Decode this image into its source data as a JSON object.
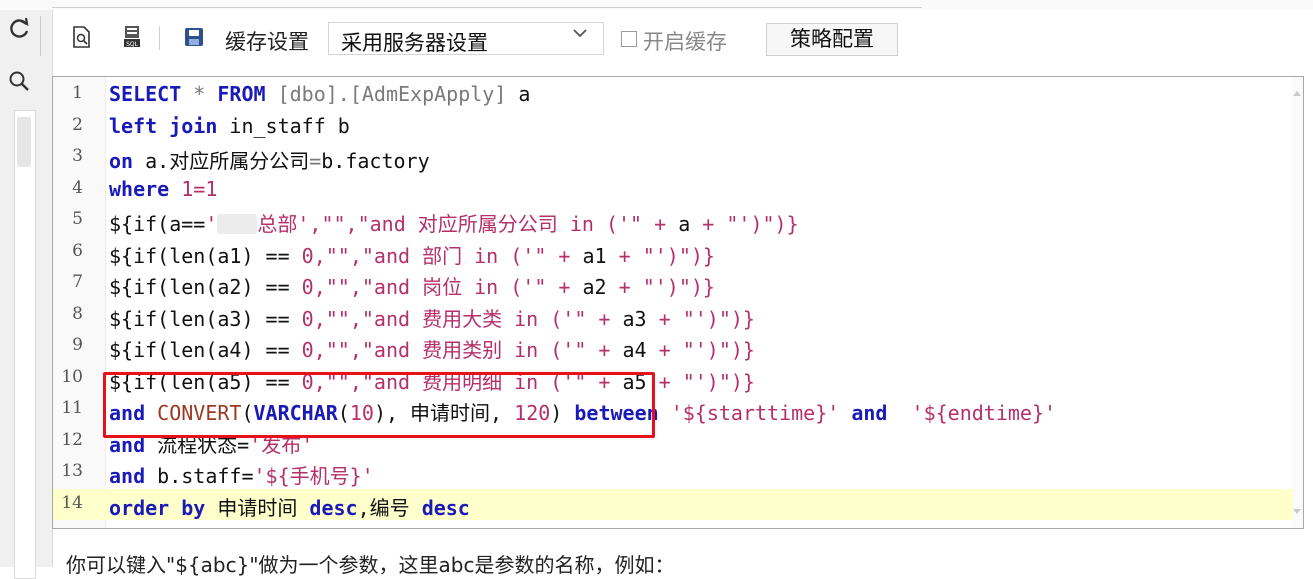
{
  "toolbar": {
    "cache_label": "缓存设置",
    "cache_select_value": "采用服务器设置",
    "enable_cache_label": "开启缓存",
    "strategy_button_label": "策略配置"
  },
  "editor": {
    "lines": [
      {
        "n": "1",
        "segs": [
          [
            "kw",
            "SELECT"
          ],
          [
            "op",
            " * "
          ],
          [
            "kw",
            "FROM"
          ],
          [
            "gray",
            " [dbo].[AdmExpApply]"
          ],
          [
            "plain",
            " a"
          ]
        ]
      },
      {
        "n": "2",
        "segs": [
          [
            "kw",
            "left join"
          ],
          [
            "plain",
            " in_staff b"
          ]
        ]
      },
      {
        "n": "3",
        "segs": [
          [
            "kw",
            "on"
          ],
          [
            "plain",
            " a.对应所属分公司"
          ],
          [
            "op",
            "="
          ],
          [
            "plain",
            "b.factory"
          ]
        ]
      },
      {
        "n": "4",
        "segs": [
          [
            "kw",
            "where"
          ],
          [
            "num",
            " 1=1"
          ]
        ]
      },
      {
        "n": "5",
        "segs": [
          [
            "plain",
            "${if(a=="
          ],
          [
            "str",
            "'"
          ],
          [
            "redact",
            ""
          ],
          [
            "str",
            "总部',\"\",\"and 对应所属分公司 in ('\" + "
          ],
          [
            "plain",
            "a"
          ],
          [
            "str",
            " + \"')\")}"
          ]
        ]
      },
      {
        "n": "6",
        "segs": [
          [
            "plain",
            "${if(len(a1) == "
          ],
          [
            "num",
            "0"
          ],
          [
            "str",
            ",\"\",\"and 部门 in ('\" + "
          ],
          [
            "plain",
            "a1"
          ],
          [
            "str",
            " + \"')\")}"
          ]
        ]
      },
      {
        "n": "7",
        "segs": [
          [
            "plain",
            "${if(len(a2) == "
          ],
          [
            "num",
            "0"
          ],
          [
            "str",
            ",\"\",\"and 岗位 in ('\" + "
          ],
          [
            "plain",
            "a2"
          ],
          [
            "str",
            " + \"')\")}"
          ]
        ]
      },
      {
        "n": "8",
        "segs": [
          [
            "plain",
            "${if(len(a3) == "
          ],
          [
            "num",
            "0"
          ],
          [
            "str",
            ",\"\",\"and 费用大类 in ('\" + "
          ],
          [
            "plain",
            "a3"
          ],
          [
            "str",
            " + \"')\")}"
          ]
        ]
      },
      {
        "n": "9",
        "segs": [
          [
            "plain",
            "${if(len(a4) == "
          ],
          [
            "num",
            "0"
          ],
          [
            "str",
            ",\"\",\"and 费用类别 in ('\" + "
          ],
          [
            "plain",
            "a4"
          ],
          [
            "str",
            " + \"')\")}"
          ]
        ]
      },
      {
        "n": "10",
        "segs": [
          [
            "plain",
            "${if(len(a5) == "
          ],
          [
            "num",
            "0"
          ],
          [
            "str",
            ",\"\",\"and 费用明细 in ('\" + "
          ],
          [
            "plain",
            "a5"
          ],
          [
            "str",
            " + \"')\")}"
          ]
        ]
      },
      {
        "n": "11",
        "segs": [
          [
            "kw",
            "and"
          ],
          [
            "fn",
            " CONVERT"
          ],
          [
            "plain",
            "("
          ],
          [
            "kw",
            "VARCHAR"
          ],
          [
            "plain",
            "("
          ],
          [
            "num",
            "10"
          ],
          [
            "plain",
            "), 申请时间, "
          ],
          [
            "num",
            "120"
          ],
          [
            "plain",
            ") "
          ],
          [
            "kw",
            "between"
          ],
          [
            "str",
            " '${starttime}'"
          ],
          [
            "kw",
            " and"
          ],
          [
            "str",
            "  '${endtime}'"
          ]
        ]
      },
      {
        "n": "12",
        "segs": [
          [
            "kw",
            "and"
          ],
          [
            "plain",
            " 流程状态="
          ],
          [
            "str",
            "'发布'"
          ]
        ]
      },
      {
        "n": "13",
        "segs": [
          [
            "kw",
            "and"
          ],
          [
            "plain",
            " b.staff="
          ],
          [
            "str",
            "'${手机号}'"
          ]
        ]
      },
      {
        "n": "14",
        "segs": [
          [
            "kw",
            "order by"
          ],
          [
            "plain",
            " 申请时间 "
          ],
          [
            "kw",
            "desc"
          ],
          [
            "plain",
            ",编号 "
          ],
          [
            "kw",
            "desc"
          ]
        ]
      }
    ],
    "active_line": 14
  },
  "hint_text": "你可以键入\"${abc}\"做为一个参数，这里abc是参数的名称，例如："
}
